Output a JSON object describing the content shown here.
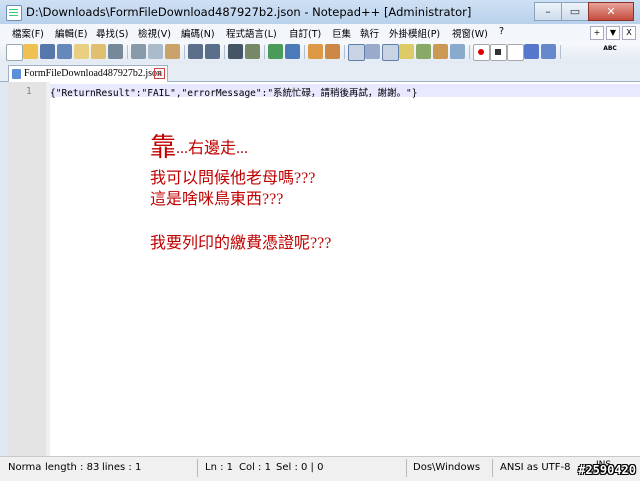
{
  "window": {
    "title": "D:\\Downloads\\FormFileDownload487927b2.json - Notepad++ [Administrator]",
    "controls": {
      "minimize": "–",
      "maximize": "▭",
      "close": "✕"
    }
  },
  "menubar": {
    "items": [
      "檔案(F)",
      "編輯(E)",
      "尋找(S)",
      "檢視(V)",
      "編碼(N)",
      "程式語言(L)",
      "自訂(T)",
      "巨集",
      "執行",
      "外掛模組(P)",
      "視窗(W)",
      "?"
    ],
    "right": [
      "+",
      "▼",
      "X"
    ]
  },
  "toolbar": {
    "icons": [
      "new-file-icon",
      "open-file-icon",
      "save-icon",
      "save-all-icon",
      "close-file-icon",
      "close-all-icon",
      "print-icon",
      "cut-icon",
      "copy-icon",
      "paste-icon",
      "undo-icon",
      "redo-icon",
      "find-icon",
      "replace-icon",
      "zoom-in-icon",
      "zoom-out-icon",
      "sync-v-icon",
      "sync-h-icon",
      "word-wrap-icon",
      "all-chars-icon",
      "indent-guide-icon",
      "udl-icon",
      "doc-map-icon",
      "function-list-icon",
      "monitor-icon",
      "record-icon",
      "stop-icon",
      "play-icon",
      "run-multi-icon",
      "save-macro-icon",
      "spellcheck-icon"
    ],
    "spellcheck_label": "ABC"
  },
  "tab": {
    "label": "FormFileDownload487927b2.json",
    "close": "x"
  },
  "editor": {
    "line_numbers": [
      "1"
    ],
    "lines": [
      "{\"ReturnResult\":\"FAIL\",\"errorMessage\":\"系統忙碌，請稍後再試，謝謝。\"}"
    ]
  },
  "annotations": {
    "line1_big": "靠",
    "line1_rest": "...右邊走...",
    "line2": "我可以問候他老母嗎???",
    "line3": "這是啥咪鳥東西???",
    "line4": "我要列印的繳費憑證呢???",
    "color": "#c00000"
  },
  "statusbar": {
    "doc_type": "Norma",
    "length": "length : 83",
    "lines": "lines : 1",
    "ln": "Ln : 1",
    "col": "Col : 1",
    "sel": "Sel : 0 | 0",
    "eol": "Dos\\Windows",
    "encoding": "ANSI as UTF-8",
    "mode": "INS",
    "watermark": "#2590420"
  }
}
